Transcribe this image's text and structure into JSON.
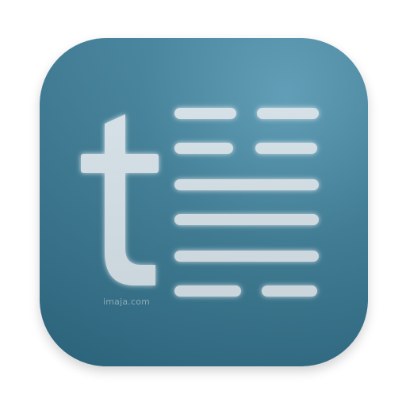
{
  "app_icon": {
    "letter": "t",
    "watermark": "imaja.com"
  },
  "colors": {
    "icon_bg": "#3f7f98",
    "glyph": "#d7e3ea",
    "glow": "#ffffff"
  },
  "lines": {
    "rows": 6
  }
}
